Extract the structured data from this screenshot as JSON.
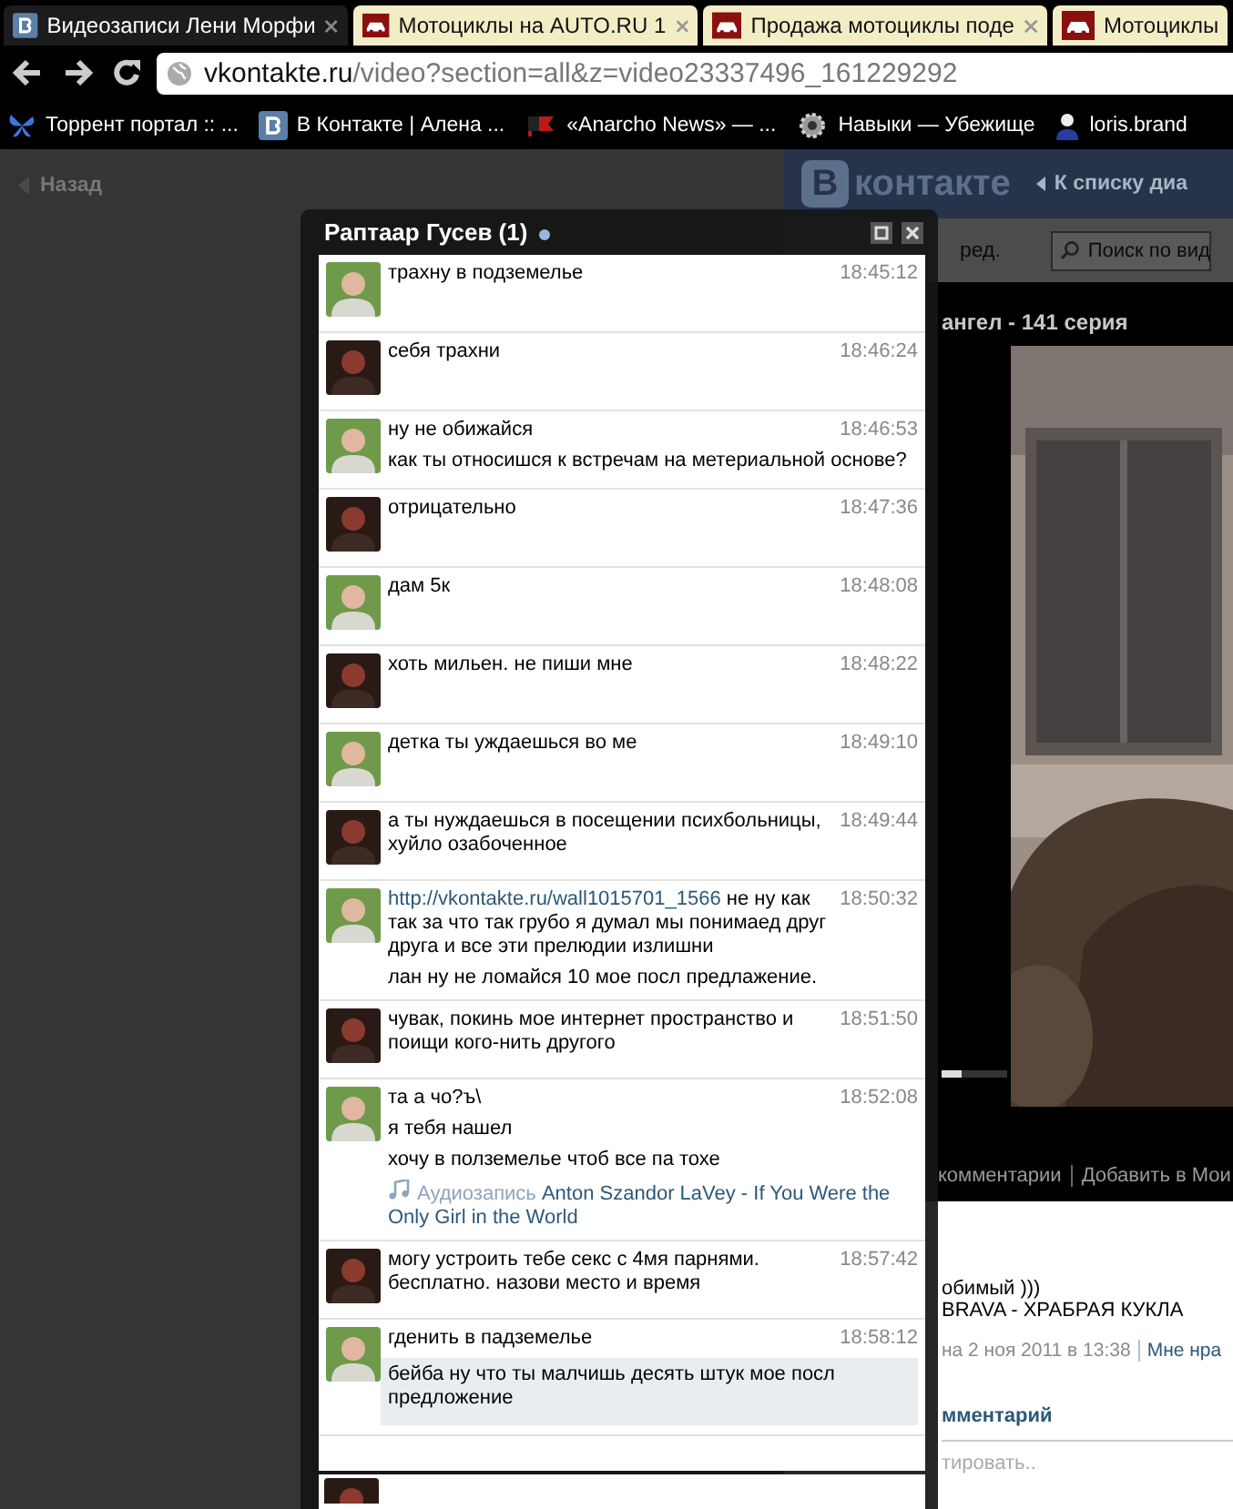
{
  "tabs": [
    {
      "title": "Видеозаписи Лени Морфи",
      "kind": "vk",
      "selected": true,
      "closable": true
    },
    {
      "title": "Мотоциклы на AUTO.RU 1",
      "kind": "auto",
      "selected": false,
      "closable": true
    },
    {
      "title": "Продажа мотоциклы поде",
      "kind": "auto",
      "selected": false,
      "closable": true
    },
    {
      "title": "Мотоциклы",
      "kind": "auto",
      "selected": false,
      "closable": false
    }
  ],
  "address": {
    "host": "vkontakte.ru",
    "path": "/video?section=all&z=video23337496_161229292"
  },
  "bookmarks": [
    {
      "title": "Торрент портал :: ...",
      "kind": "butterfly"
    },
    {
      "title": "В Контакте | Алена ...",
      "kind": "vk"
    },
    {
      "title": "«Anarcho News» — ...",
      "kind": "flag"
    },
    {
      "title": "Навыки — Убежище",
      "kind": "gear"
    },
    {
      "title": "loris.brand",
      "kind": "person"
    }
  ],
  "page": {
    "back": "Назад",
    "logo_letter": "В",
    "logo": "контакте",
    "back_to_list": "К списку диа",
    "edit": "ред.",
    "search": {
      "placeholder": "Поиск по вид"
    },
    "video_title": "ангел - 141 серия",
    "seek": {
      "level": 0.3
    },
    "links": [
      "комментарии",
      "Добавить в Мои"
    ],
    "description": [
      "обимый )))",
      "BRAVA - ХРАБРАЯ КУКЛА"
    ],
    "date": "на 2 ноя 2011 в 13:38",
    "like": "Мне нра",
    "comments_heading": "мментарий",
    "comment_field": {
      "placeholder": "тировать.."
    }
  },
  "chat": {
    "title": "Раптаар Гусев (1)",
    "online": true,
    "messages": [
      {
        "kind": "contact",
        "time": "18:45:12",
        "lines": [
          {
            "text": "трахну в подземелье",
            "unread": false
          }
        ]
      },
      {
        "kind": "self",
        "time": "18:46:24",
        "lines": [
          {
            "text": "себя трахни",
            "unread": false
          }
        ]
      },
      {
        "kind": "contact",
        "time": "18:46:53",
        "lines": [
          {
            "text": "ну не обижайся",
            "unread": false
          },
          {
            "text": "как ты относишся к встречам на метериальной основе?",
            "unread": false
          }
        ]
      },
      {
        "kind": "self",
        "time": "18:47:36",
        "lines": [
          {
            "text": "отрицательно",
            "unread": false
          }
        ]
      },
      {
        "kind": "contact",
        "time": "18:48:08",
        "lines": [
          {
            "text": "дам 5к",
            "unread": false
          }
        ]
      },
      {
        "kind": "self",
        "time": "18:48:22",
        "lines": [
          {
            "text": "хоть мильен. не пиши мне",
            "unread": false
          }
        ]
      },
      {
        "kind": "contact",
        "time": "18:49:10",
        "lines": [
          {
            "text": "детка ты уждаешься во ме",
            "unread": false
          }
        ]
      },
      {
        "kind": "self",
        "time": "18:49:44",
        "lines": [
          {
            "text": "а ты нуждаешься в посещении психбольницы, хуйло озабоченное",
            "unread": false
          }
        ]
      },
      {
        "kind": "contact",
        "time": "18:50:32",
        "lines": [
          {
            "link": "http://vkontakte.ru/wall1015701_1566",
            "text": "не ну как так за что так грубо я думал мы понимаед друг друга и все эти прелюдии излишни",
            "unread": false
          },
          {
            "text": "лан ну не ломайся 10 мое посл предлажение.",
            "unread": false
          }
        ]
      },
      {
        "kind": "self",
        "time": "18:51:50",
        "lines": [
          {
            "text": "чувак, покинь мое интернет пространство и поищи кого-нить другого",
            "unread": false
          }
        ]
      },
      {
        "kind": "contact",
        "time": "18:52:08",
        "lines": [
          {
            "text": "та а чо?ъ\\",
            "unread": false
          },
          {
            "text": "я тебя нашел",
            "unread": false
          },
          {
            "text": "хочу в полземелье чтоб все па тохе",
            "unread": false
          },
          {
            "kind": "audio",
            "label": "Аудиозапись",
            "title": "Anton Szandor LaVey - If You Were the Only Girl in the World",
            "unread": false
          }
        ]
      },
      {
        "kind": "self",
        "time": "18:57:42",
        "lines": [
          {
            "text": "могу устроить тебе секс с 4мя парнями. бесплатно. назови место и время",
            "unread": false
          }
        ]
      },
      {
        "kind": "contact",
        "time": "18:58:12",
        "lines": [
          {
            "text": "гденить в падземелье",
            "unread": false
          },
          {
            "text": "бейба ну что ты малчишь десять штук мое посл предложение",
            "unread": true
          }
        ]
      }
    ]
  }
}
